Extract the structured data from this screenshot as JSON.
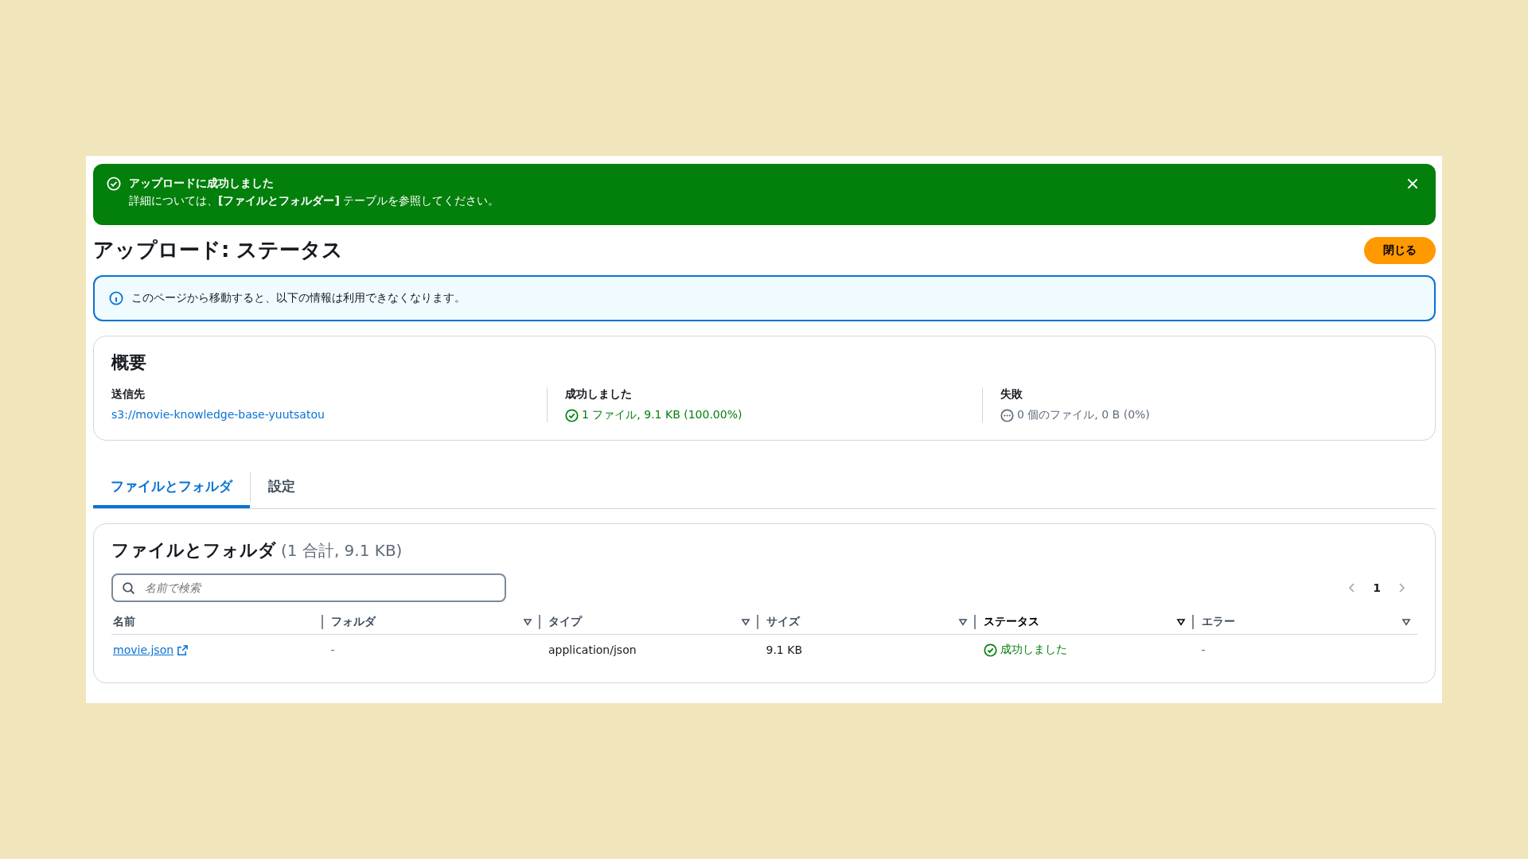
{
  "flash": {
    "title": "アップロードに成功しました",
    "message": "詳細については、**[ファイルとフォルダー]** テーブルを参照してください。"
  },
  "header": {
    "title": "アップロード: ステータス",
    "button": "閉じる"
  },
  "info": {
    "message": "このページから移動すると、以下の情報は利用できなくなります。"
  },
  "summary": {
    "title": "概要",
    "items": [
      {
        "kind": "link",
        "label": "送信先",
        "value": "s3://movie-knowledge-base-yuutsatou"
      },
      {
        "kind": "success",
        "label": "成功しました",
        "value": "1 ファイル, 9.1 KB (100.00%)"
      },
      {
        "kind": "pending",
        "label": "失敗",
        "value": "0 個のファイル, 0 B (0%)"
      }
    ]
  },
  "tabs": [
    {
      "label": "ファイルとフォルダ",
      "selected": true
    },
    {
      "label": "設定",
      "selected": false
    }
  ],
  "table": {
    "title": "ファイルとフォルダ",
    "count": "(1 合計, 9.1 KB)",
    "search": {
      "placeholder": "名前で検索"
    },
    "page": "1",
    "columns": [
      {
        "label": "名前",
        "filter": false,
        "sorted": false
      },
      {
        "label": "フォルダ",
        "filter": true,
        "sorted": false
      },
      {
        "label": "タイプ",
        "filter": true,
        "sorted": false
      },
      {
        "label": "サイズ",
        "filter": true,
        "sorted": false
      },
      {
        "label": "ステータス",
        "filter": true,
        "sorted": true
      },
      {
        "label": "エラー",
        "filter": true,
        "sorted": false
      }
    ],
    "rows": [
      [
        {
          "kind": "link",
          "text": "movie.json"
        },
        {
          "kind": "dash",
          "text": "-"
        },
        {
          "kind": "text",
          "text": "application/json"
        },
        {
          "kind": "text",
          "text": "9.1 KB"
        },
        {
          "kind": "success",
          "text": "成功しました"
        },
        {
          "kind": "dash",
          "text": "-"
        }
      ]
    ]
  }
}
